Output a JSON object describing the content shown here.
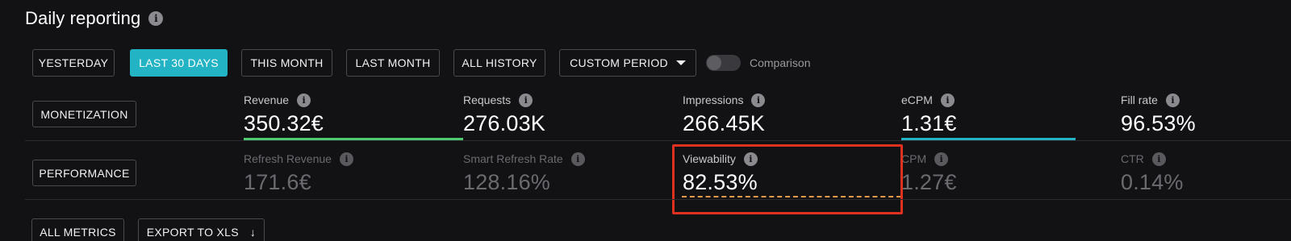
{
  "header": {
    "title": "Daily reporting"
  },
  "periods": {
    "yesterday": "YESTERDAY",
    "last_30_days": "LAST 30 DAYS",
    "this_month": "THIS MONTH",
    "last_month": "LAST MONTH",
    "all_history": "ALL HISTORY",
    "custom_period": "CUSTOM PERIOD",
    "active": "LAST 30 DAYS"
  },
  "comparison": {
    "label": "Comparison",
    "enabled": false
  },
  "sections": {
    "monetization": "MONETIZATION",
    "performance": "PERFORMANCE"
  },
  "monetization_metrics": [
    {
      "label": "Revenue",
      "value": "350.32€",
      "underline_color": "#4ecb71"
    },
    {
      "label": "Requests",
      "value": "276.03K"
    },
    {
      "label": "Impressions",
      "value": "266.45K"
    },
    {
      "label": "eCPM",
      "value": "1.31€",
      "underline_color": "#22b3c5"
    },
    {
      "label": "Fill rate",
      "value": "96.53%"
    }
  ],
  "performance_metrics": [
    {
      "label": "Refresh Revenue",
      "value": "171.6€"
    },
    {
      "label": "Smart Refresh Rate",
      "value": "128.16%"
    },
    {
      "label": "Viewability",
      "value": "82.53%",
      "highlighted": true,
      "underline_color": "#e89a4c"
    },
    {
      "label": "CPM",
      "value": "1.27€"
    },
    {
      "label": "CTR",
      "value": "0.14%"
    }
  ],
  "footer": {
    "all_metrics": "ALL METRICS",
    "export": "EXPORT TO XLS",
    "export_icon": "download-arrow-icon"
  },
  "colors": {
    "accent": "#22b3c5",
    "highlight_box": "#e0301e",
    "background": "#121114"
  }
}
